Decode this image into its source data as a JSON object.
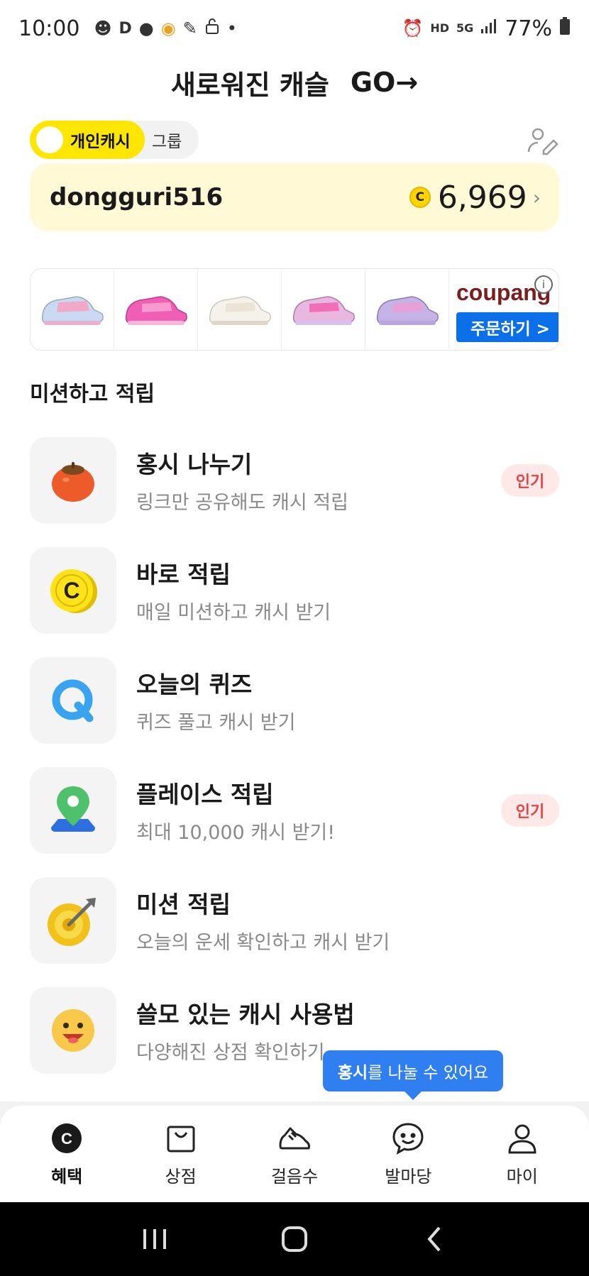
{
  "status_bar": {
    "time": "10:00",
    "battery": "77%",
    "left_icons": [
      "person-icon",
      "dx-icon",
      "chat-icon",
      "game-icon",
      "pen-icon",
      "unlock-icon",
      "dot-icon"
    ],
    "right_icons": [
      "alarm-icon",
      "hd-voice-icon",
      "5g-icon",
      "signal-icon",
      "battery-icon"
    ],
    "hd_label": "HD",
    "g5_label": "5G"
  },
  "header": {
    "title": "새로워진 캐슬",
    "go_label": "GO→"
  },
  "toggle": {
    "personal_label": "개인캐시",
    "group_label": "그룹"
  },
  "cash": {
    "username": "dongguri516",
    "coin_symbol": "C",
    "amount": "6,969",
    "chevron": "›"
  },
  "ad": {
    "brand": "coupang",
    "order_label": "주문하기 >",
    "info_symbol": "i",
    "thumbnails": [
      "shoe-pink-blue",
      "shoe-pink",
      "shoe-white",
      "shoe-pink-purple",
      "shoe-purple"
    ]
  },
  "section": {
    "title": "미션하고 적립"
  },
  "missions": [
    {
      "title": "홍시 나누기",
      "subtitle": "링크만 공유해도 캐시 적립",
      "badge": "인기",
      "icon": "persimmon-icon"
    },
    {
      "title": "바로 적립",
      "subtitle": "매일 미션하고 캐시 받기",
      "badge": "",
      "icon": "coin-icon"
    },
    {
      "title": "오늘의 퀴즈",
      "subtitle": "퀴즈 풀고 캐시 받기",
      "badge": "",
      "icon": "quiz-icon"
    },
    {
      "title": "플레이스 적립",
      "subtitle": "최대 10,000 캐시 받기!",
      "badge": "인기",
      "icon": "map-pin-icon"
    },
    {
      "title": "미션 적립",
      "subtitle": "오늘의 운세 확인하고 캐시 받기",
      "badge": "",
      "icon": "target-icon"
    },
    {
      "title": "쓸모 있는 캐시 사용법",
      "subtitle": "다양해진 상점 확인하기",
      "badge": "",
      "icon": "smile-face-icon"
    }
  ],
  "tooltip": {
    "bold": "홍시",
    "rest": "를 나눌 수 있어요"
  },
  "bottom_nav": [
    {
      "label": "혜택",
      "icon": "benefit-icon",
      "active": true
    },
    {
      "label": "상점",
      "icon": "shop-icon",
      "active": false
    },
    {
      "label": "걸음수",
      "icon": "shoe-icon",
      "active": false
    },
    {
      "label": "발마당",
      "icon": "chat-smile-icon",
      "active": false
    },
    {
      "label": "마이",
      "icon": "person-icon",
      "active": false
    }
  ],
  "colors": {
    "accent_yellow": "#ffe600",
    "card_yellow": "#fff9d6",
    "badge_bg": "#ffe8e8",
    "badge_text": "#e04646",
    "tooltip_blue": "#2f7ff0",
    "coupang_blue": "#0a6fe8"
  }
}
